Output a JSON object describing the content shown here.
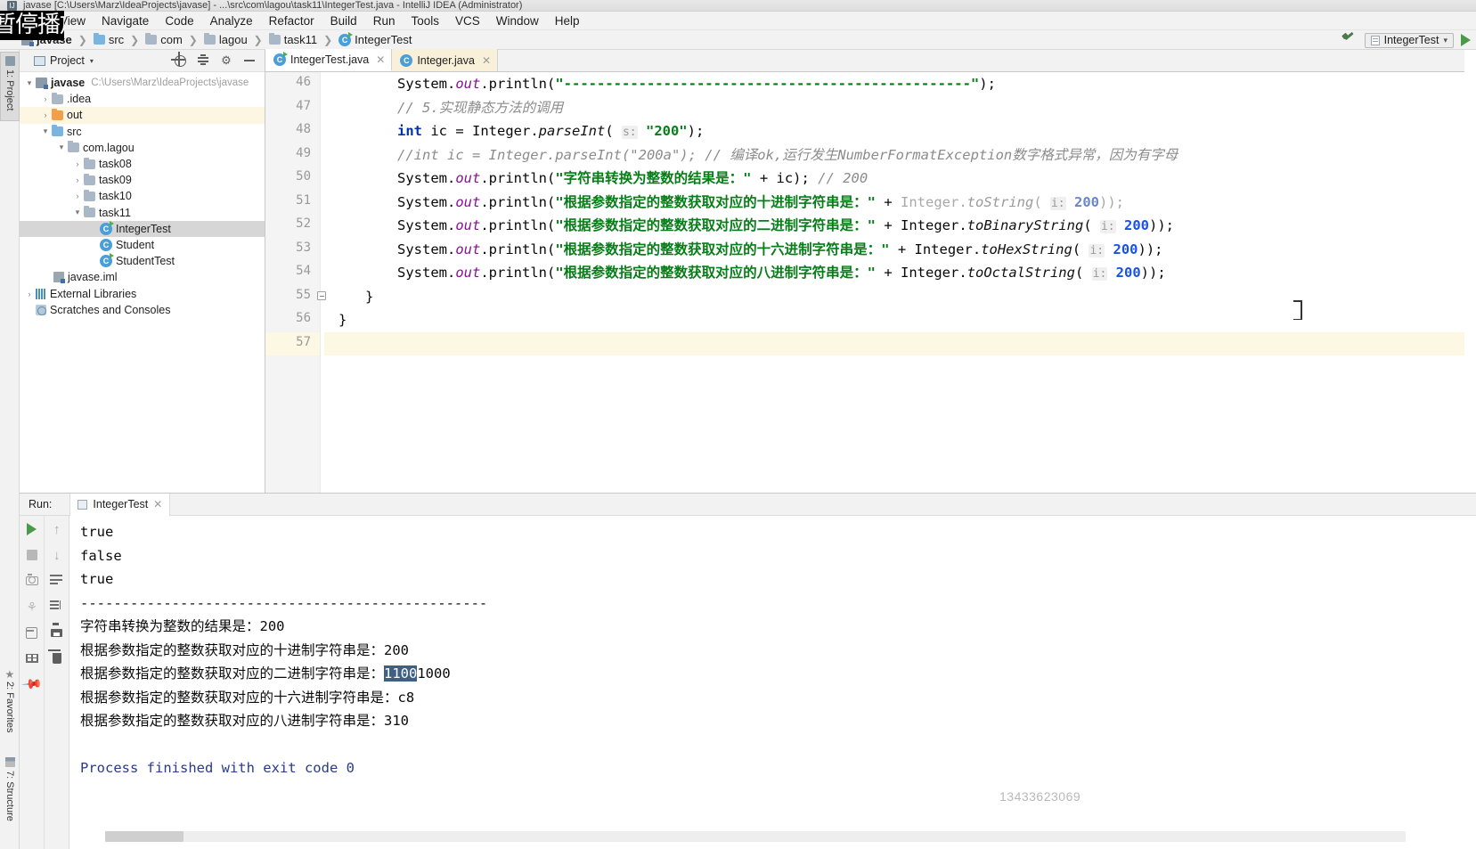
{
  "window": {
    "title": "javase [C:\\Users\\Marz\\IdeaProjects\\javase] - ...\\src\\com\\lagou\\task11\\IntegerTest.java - IntelliJ IDEA (Administrator)",
    "app_icon": "intellij-idea-icon"
  },
  "overlay": {
    "pause_text": "暂停播放"
  },
  "menu": {
    "items": [
      {
        "label": "View"
      },
      {
        "label": "Navigate"
      },
      {
        "label": "Code"
      },
      {
        "label": "Analyze"
      },
      {
        "label": "Refactor"
      },
      {
        "label": "Build"
      },
      {
        "label": "Run"
      },
      {
        "label": "Tools"
      },
      {
        "label": "VCS"
      },
      {
        "label": "Window"
      },
      {
        "label": "Help"
      }
    ]
  },
  "breadcrumb": {
    "items": [
      {
        "label": "javase",
        "icon": "module-icon"
      },
      {
        "label": "src",
        "icon": "source-folder-icon"
      },
      {
        "label": "com",
        "icon": "folder-icon"
      },
      {
        "label": "lagou",
        "icon": "folder-icon"
      },
      {
        "label": "task11",
        "icon": "folder-icon"
      },
      {
        "label": "IntegerTest",
        "icon": "java-class-icon"
      }
    ],
    "separator": "❯"
  },
  "toolbar_right": {
    "build_icon": "hammer-icon",
    "run_config": "IntegerTest",
    "run_config_icon": "run-config-icon",
    "dropdown_icon": "chevron-down-icon",
    "run_icon": "run-play-icon"
  },
  "left_tool_strip": {
    "tabs": [
      {
        "label": "1: Project",
        "icon": "project-icon",
        "active": true
      },
      {
        "label": "2: Favorites",
        "icon": "star-icon",
        "active": false
      },
      {
        "label": "7: Structure",
        "icon": "structure-icon",
        "active": false
      }
    ]
  },
  "project_panel": {
    "title": "Project",
    "caret_icon": "chevron-down-icon",
    "actions": [
      {
        "icon": "locate-target-icon"
      },
      {
        "icon": "collapse-all-icon"
      },
      {
        "icon": "gear-icon"
      },
      {
        "icon": "hide-icon"
      }
    ],
    "tree": [
      {
        "depth": 0,
        "twisty": "▾",
        "icon": "module-icon",
        "name": "javase",
        "path": "C:\\Users\\Marz\\IdeaProjects\\javase",
        "bold": true
      },
      {
        "depth": 1,
        "twisty": "›",
        "icon": "folder-icon",
        "name": ".idea"
      },
      {
        "depth": 1,
        "twisty": "›",
        "icon": "folder-orange-icon",
        "name": "out",
        "highlight": true
      },
      {
        "depth": 1,
        "twisty": "▾",
        "icon": "source-folder-icon",
        "name": "src"
      },
      {
        "depth": 2,
        "twisty": "▾",
        "icon": "package-icon",
        "name": "com.lagou"
      },
      {
        "depth": 3,
        "twisty": "›",
        "icon": "package-icon",
        "name": "task08"
      },
      {
        "depth": 3,
        "twisty": "›",
        "icon": "package-icon",
        "name": "task09"
      },
      {
        "depth": 3,
        "twisty": "›",
        "icon": "package-icon",
        "name": "task10"
      },
      {
        "depth": 3,
        "twisty": "▾",
        "icon": "package-icon",
        "name": "task11"
      },
      {
        "depth": 4,
        "twisty": "",
        "icon": "java-runnable-class-icon",
        "name": "IntegerTest",
        "selected": true
      },
      {
        "depth": 4,
        "twisty": "",
        "icon": "java-class-icon",
        "name": "Student"
      },
      {
        "depth": 4,
        "twisty": "",
        "icon": "java-runnable-class-icon",
        "name": "StudentTest"
      },
      {
        "depth": 1,
        "twisty": "",
        "icon": "iml-file-icon",
        "name": "javase.iml"
      },
      {
        "depth": 0,
        "twisty": "›",
        "icon": "libraries-icon",
        "name": "External Libraries"
      },
      {
        "depth": 0,
        "twisty": "",
        "icon": "scratches-icon",
        "name": "Scratches and Consoles"
      }
    ]
  },
  "editor": {
    "tabs": [
      {
        "label": "IntegerTest.java",
        "icon": "java-runnable-class-icon",
        "active": true,
        "close_icon": "close-icon"
      },
      {
        "label": "Integer.java",
        "icon": "java-class-icon",
        "active": false,
        "close_icon": "close-icon"
      }
    ],
    "line_numbers": [
      "46",
      "47",
      "48",
      "49",
      "50",
      "51",
      "52",
      "53",
      "54",
      "55",
      "56",
      "57"
    ],
    "current_line": "57",
    "fold_marker_line": "55",
    "lines": [
      {
        "n": "46",
        "tokens": [
          {
            "t": "System.",
            "c": "plain"
          },
          {
            "t": "out",
            "c": "field"
          },
          {
            "t": ".println(",
            "c": "plain"
          },
          {
            "t": "\"-------------------------------------------------\"",
            "c": "string"
          },
          {
            "t": ");",
            "c": "plain"
          }
        ]
      },
      {
        "n": "47",
        "tokens": [
          {
            "t": "// 5.实现静态方法的调用",
            "c": "comment"
          }
        ]
      },
      {
        "n": "48",
        "tokens": [
          {
            "t": "int",
            "c": "keyword"
          },
          {
            "t": " ic = Integer.",
            "c": "plain"
          },
          {
            "t": "parseInt",
            "c": "method"
          },
          {
            "t": "( ",
            "c": "plain"
          },
          {
            "t": "s:",
            "c": "hint"
          },
          {
            "t": " ",
            "c": "plain"
          },
          {
            "t": "\"200\"",
            "c": "string"
          },
          {
            "t": ");",
            "c": "plain"
          }
        ]
      },
      {
        "n": "49",
        "tokens": [
          {
            "t": "//int ic = Integer.parseInt(\"200a\"); // 编译ok,运行发生NumberFormatException数字格式异常，因为有字母",
            "c": "comment"
          }
        ]
      },
      {
        "n": "50",
        "tokens": [
          {
            "t": "System.",
            "c": "plain"
          },
          {
            "t": "out",
            "c": "field"
          },
          {
            "t": ".println(",
            "c": "plain"
          },
          {
            "t": "\"字符串转换为整数的结果是：\"",
            "c": "string"
          },
          {
            "t": " + ic); ",
            "c": "plain"
          },
          {
            "t": "// 200",
            "c": "comment"
          }
        ]
      },
      {
        "n": "51",
        "tokens": [
          {
            "t": "System.",
            "c": "plain"
          },
          {
            "t": "out",
            "c": "field"
          },
          {
            "t": ".println(",
            "c": "plain"
          },
          {
            "t": "\"根据参数指定的整数获取对应的十进制字符串是：\"",
            "c": "string"
          },
          {
            "t": " + Integer.",
            "c": "plain"
          },
          {
            "t": "toString",
            "c": "method-gray"
          },
          {
            "t": "( ",
            "c": "gray"
          },
          {
            "t": "i:",
            "c": "hint"
          },
          {
            "t": " ",
            "c": "plain"
          },
          {
            "t": "200",
            "c": "number-gray"
          },
          {
            "t": "));",
            "c": "gray"
          }
        ]
      },
      {
        "n": "52",
        "tokens": [
          {
            "t": "System.",
            "c": "plain"
          },
          {
            "t": "out",
            "c": "field"
          },
          {
            "t": ".println(",
            "c": "plain"
          },
          {
            "t": "\"根据参数指定的整数获取对应的二进制字符串是：\"",
            "c": "string"
          },
          {
            "t": " + Integer.",
            "c": "plain"
          },
          {
            "t": "toBinaryString",
            "c": "method"
          },
          {
            "t": "( ",
            "c": "plain"
          },
          {
            "t": "i:",
            "c": "hint"
          },
          {
            "t": " ",
            "c": "plain"
          },
          {
            "t": "200",
            "c": "number"
          },
          {
            "t": "));",
            "c": "plain"
          }
        ]
      },
      {
        "n": "53",
        "tokens": [
          {
            "t": "System.",
            "c": "plain"
          },
          {
            "t": "out",
            "c": "field"
          },
          {
            "t": ".println(",
            "c": "plain"
          },
          {
            "t": "\"根据参数指定的整数获取对应的十六进制字符串是：\"",
            "c": "string"
          },
          {
            "t": " + Integer.",
            "c": "plain"
          },
          {
            "t": "toHexString",
            "c": "method"
          },
          {
            "t": "( ",
            "c": "plain"
          },
          {
            "t": "i:",
            "c": "hint"
          },
          {
            "t": " ",
            "c": "plain"
          },
          {
            "t": "200",
            "c": "number"
          },
          {
            "t": "));",
            "c": "plain"
          }
        ]
      },
      {
        "n": "54",
        "tokens": [
          {
            "t": "System.",
            "c": "plain"
          },
          {
            "t": "out",
            "c": "field"
          },
          {
            "t": ".println(",
            "c": "plain"
          },
          {
            "t": "\"根据参数指定的整数获取对应的八进制字符串是：\"",
            "c": "string"
          },
          {
            "t": " + Integer.",
            "c": "plain"
          },
          {
            "t": "toOctalString",
            "c": "method"
          },
          {
            "t": "( ",
            "c": "plain"
          },
          {
            "t": "i:",
            "c": "hint"
          },
          {
            "t": " ",
            "c": "plain"
          },
          {
            "t": "200",
            "c": "number"
          },
          {
            "t": "));",
            "c": "plain"
          }
        ]
      },
      {
        "n": "55",
        "indent": "small",
        "tokens": [
          {
            "t": "}",
            "c": "plain"
          }
        ]
      },
      {
        "n": "56",
        "indent": "zero",
        "tokens": [
          {
            "t": "}",
            "c": "plain"
          }
        ]
      },
      {
        "n": "57",
        "indent": "zero",
        "current": true,
        "tokens": [
          {
            "t": "",
            "c": "plain"
          }
        ]
      }
    ],
    "text_cursor_icon": "text-caret-icon"
  },
  "run_panel": {
    "label": "Run:",
    "tab": {
      "label": "IntegerTest",
      "icon": "run-config-icon",
      "close_icon": "close-icon"
    },
    "toolbar_col1": [
      {
        "icon": "rerun-play-icon"
      },
      {
        "icon": "stop-icon"
      },
      {
        "icon": "camera-icon"
      },
      {
        "icon": "rerun-failed-tests-icon"
      },
      {
        "icon": "export-icon"
      },
      {
        "icon": "layout-icon"
      },
      {
        "icon": "pin-icon"
      }
    ],
    "toolbar_col2": [
      {
        "icon": "arrow-up-icon"
      },
      {
        "icon": "arrow-down-icon"
      },
      {
        "icon": "soft-wrap-icon"
      },
      {
        "icon": "scroll-to-end-icon"
      },
      {
        "icon": "print-icon"
      },
      {
        "icon": "trash-icon"
      }
    ],
    "output": [
      {
        "text": "true"
      },
      {
        "text": "false"
      },
      {
        "text": "true"
      },
      {
        "text": "-------------------------------------------------"
      },
      {
        "text": "字符串转换为整数的结果是：200"
      },
      {
        "text": "根据参数指定的整数获取对应的十进制字符串是：200"
      },
      {
        "prefix": "根据参数指定的整数获取对应的二进制字符串是：",
        "selected": "1100",
        "suffix": "1000"
      },
      {
        "text": "根据参数指定的整数获取对应的十六进制字符串是：c8"
      },
      {
        "text": "根据参数指定的整数获取对应的八进制字符串是：310"
      },
      {
        "text": ""
      },
      {
        "text": "Process finished with exit code 0",
        "style": "exit"
      }
    ],
    "scrollbar": {
      "icon": "horizontal-scrollbar"
    }
  },
  "watermark": {
    "text": "13433623069"
  }
}
